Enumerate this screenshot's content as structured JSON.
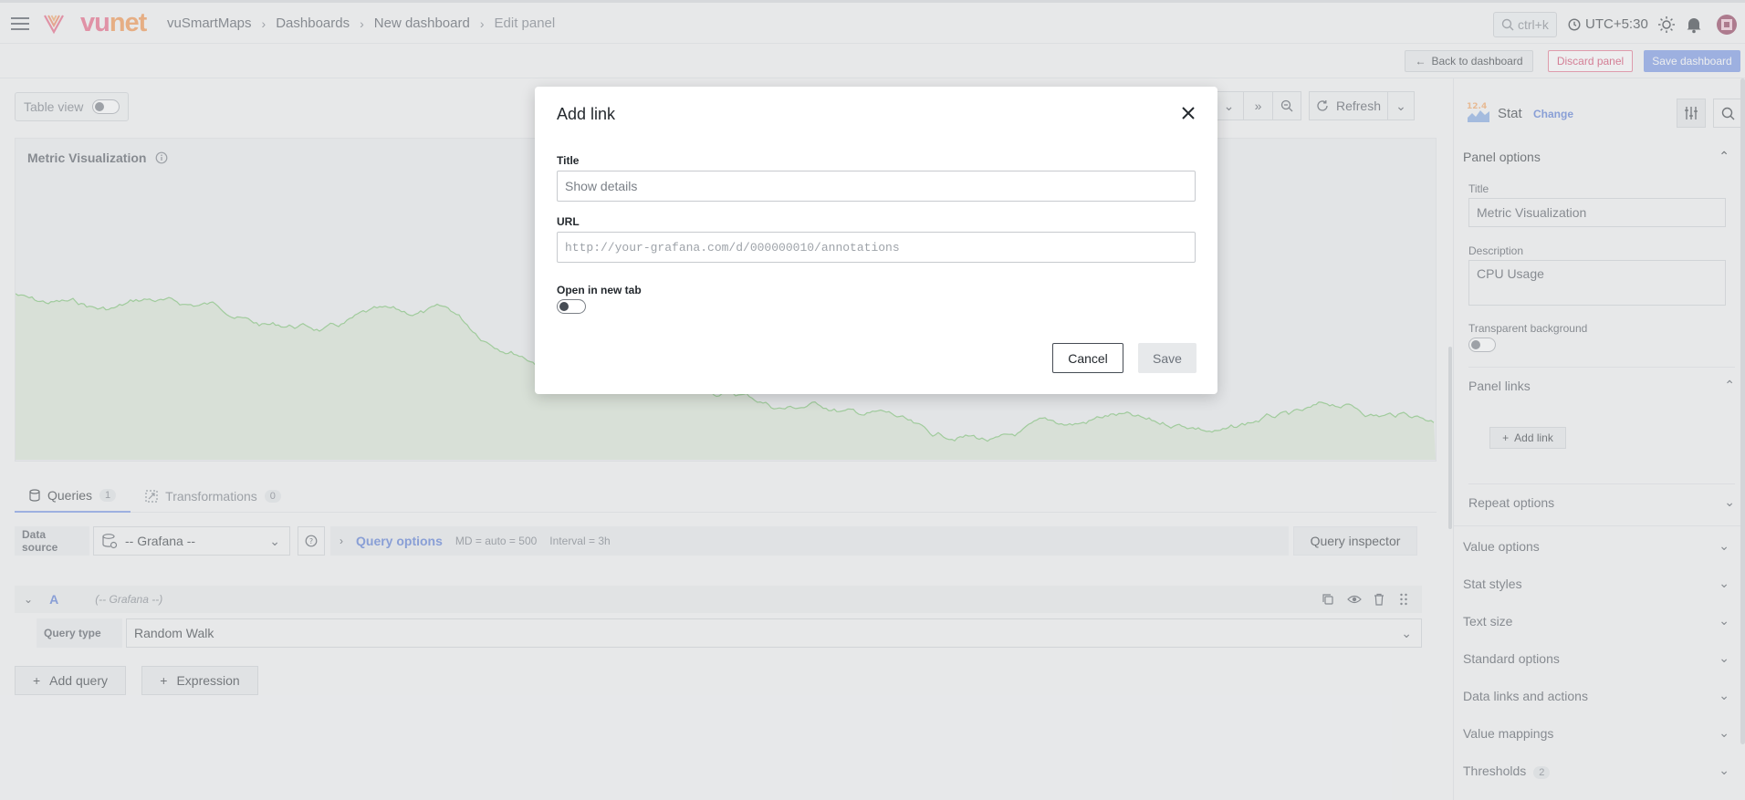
{
  "header": {
    "brand_v": "vu",
    "brand_net": "net",
    "breadcrumbs": [
      "vuSmartMaps",
      "Dashboards",
      "New dashboard",
      "Edit panel"
    ],
    "search_shortcut": "ctrl+k",
    "timezone": "UTC+5:30"
  },
  "toolbar": {
    "back_label": "Back to dashboard",
    "discard_label": "Discard panel",
    "save_label": "Save dashboard"
  },
  "editor": {
    "table_view_label": "Table view",
    "refresh_label": "Refresh",
    "panel_title": "Metric Visualization"
  },
  "query_tabs": [
    {
      "label": "Queries",
      "count": "1"
    },
    {
      "label": "Transformations",
      "count": "0"
    }
  ],
  "datasource": {
    "label": "Data source",
    "value": "-- Grafana --",
    "query_options_label": "Query options",
    "md": "MD = auto = 500",
    "interval": "Interval = 3h",
    "inspector_label": "Query inspector"
  },
  "query": {
    "ref_id": "A",
    "source_hint": "(-- Grafana --)",
    "type_label": "Query type",
    "type_value": "Random Walk",
    "add_query_label": "Add query",
    "expression_label": "Expression"
  },
  "options_pane": {
    "viz_badge": "12.4",
    "viz_name": "Stat",
    "change_label": "Change",
    "panel_options_label": "Panel options",
    "title_label": "Title",
    "title_value": "Metric Visualization",
    "description_label": "Description",
    "description_value": "CPU Usage",
    "transparent_label": "Transparent background",
    "panel_links_label": "Panel links",
    "add_link_label": "Add link",
    "repeat_label": "Repeat options",
    "sections": [
      "Value options",
      "Stat styles",
      "Text size",
      "Standard options",
      "Data links and actions",
      "Value mappings",
      "Thresholds"
    ],
    "thresholds_count": "2"
  },
  "modal": {
    "title": "Add link",
    "title_field_label": "Title",
    "title_placeholder": "Show details",
    "url_field_label": "URL",
    "url_placeholder": "http://your-grafana.com/d/000000010/annotations",
    "new_tab_label": "Open in new tab",
    "cancel_label": "Cancel",
    "save_label": "Save"
  },
  "colors": {
    "accent": "#6e8fe4",
    "danger": "#d1345b",
    "series_line": "#73bf69"
  }
}
